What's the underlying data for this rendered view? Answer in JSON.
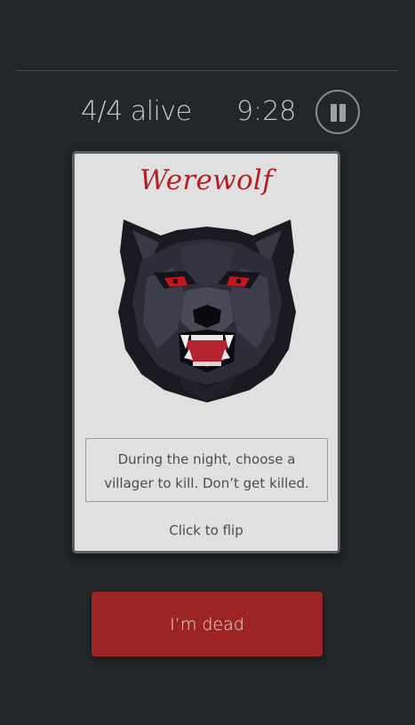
{
  "header": {
    "alive_text": "4/4 alive",
    "timer": "9:28",
    "pause_icon": "pause-icon"
  },
  "card": {
    "title": "Werewolf",
    "image": "werewolf-pixel-art",
    "description": "During the night, choose a villager to kill. Don’t get killed.",
    "flip_hint": "Click to flip"
  },
  "actions": {
    "dead_label": "I’m dead"
  },
  "colors": {
    "background": "#232729",
    "accent_red": "#9c2424",
    "title_red": "#b02226",
    "card": "#e0e0e0"
  }
}
